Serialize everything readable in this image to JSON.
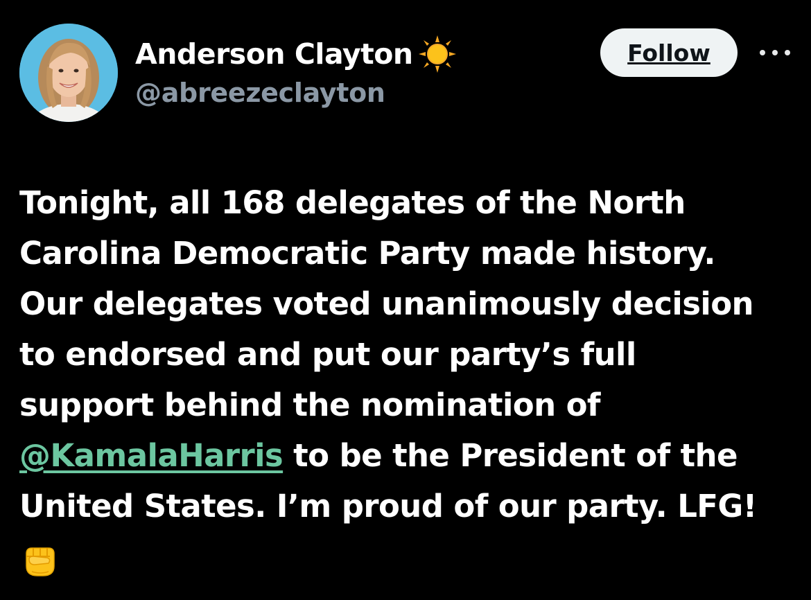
{
  "author": {
    "display_name": "Anderson Clayton",
    "name_emoji": "sun-icon",
    "handle": "@abreezeclayton",
    "avatar": "avatar"
  },
  "actions": {
    "follow_label": "Follow",
    "more_icon": "more-icon"
  },
  "tweet": {
    "line_1": "Tonight, all 168 delegates of the North",
    "line_2": "Carolina Democratic Party made history.",
    "line_3": "Our delegates voted unanimously decision",
    "line_4": "to endorsed and put our party’s full",
    "line_5": "support behind the nomination of",
    "mention": "@KamalaHarris",
    "line_6_rest": " to be the President of the",
    "line_7": "United States. I’m proud of our party. LFG!",
    "end_emoji": "fist-icon"
  },
  "colors": {
    "background": "#000000",
    "text": "#ffffff",
    "handle": "#8b98a5",
    "mention": "#6cc6a0",
    "follow_button_bg": "#eff3f4"
  }
}
